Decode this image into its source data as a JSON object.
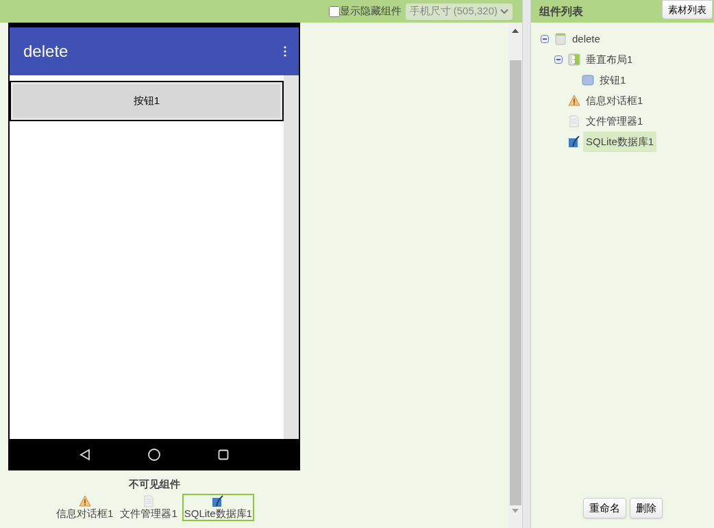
{
  "toolbar": {
    "show_hidden": {
      "label": "显示隐藏组件",
      "checked": false
    },
    "size_select": {
      "value": "手机尺寸 (505,320)"
    }
  },
  "phone": {
    "app_title": "delete",
    "button": {
      "label": "按钮1"
    }
  },
  "nonvisible": {
    "title": "不可见组件",
    "items": [
      {
        "kind": "notifier",
        "label": "信息对话框1",
        "selected": false
      },
      {
        "kind": "file",
        "label": "文件管理器1",
        "selected": false
      },
      {
        "kind": "sqlite",
        "label": "SQLite数据库1",
        "selected": true
      }
    ]
  },
  "components_panel": {
    "title": "组件列表",
    "assets_button": "素材列表",
    "tree": [
      {
        "kind": "screen",
        "label": "delete",
        "selected": false,
        "expanded": true,
        "children": [
          {
            "kind": "vertical",
            "label": "垂直布局1",
            "selected": false,
            "expanded": true,
            "children": [
              {
                "kind": "button",
                "label": "按钮1",
                "selected": false
              }
            ]
          },
          {
            "kind": "notifier",
            "label": "信息对话框1",
            "selected": false
          },
          {
            "kind": "file",
            "label": "文件管理器1",
            "selected": false
          },
          {
            "kind": "sqlite",
            "label": "SQLite数据库1",
            "selected": true
          }
        ]
      }
    ],
    "buttons": [
      "重命名",
      "删除"
    ]
  }
}
